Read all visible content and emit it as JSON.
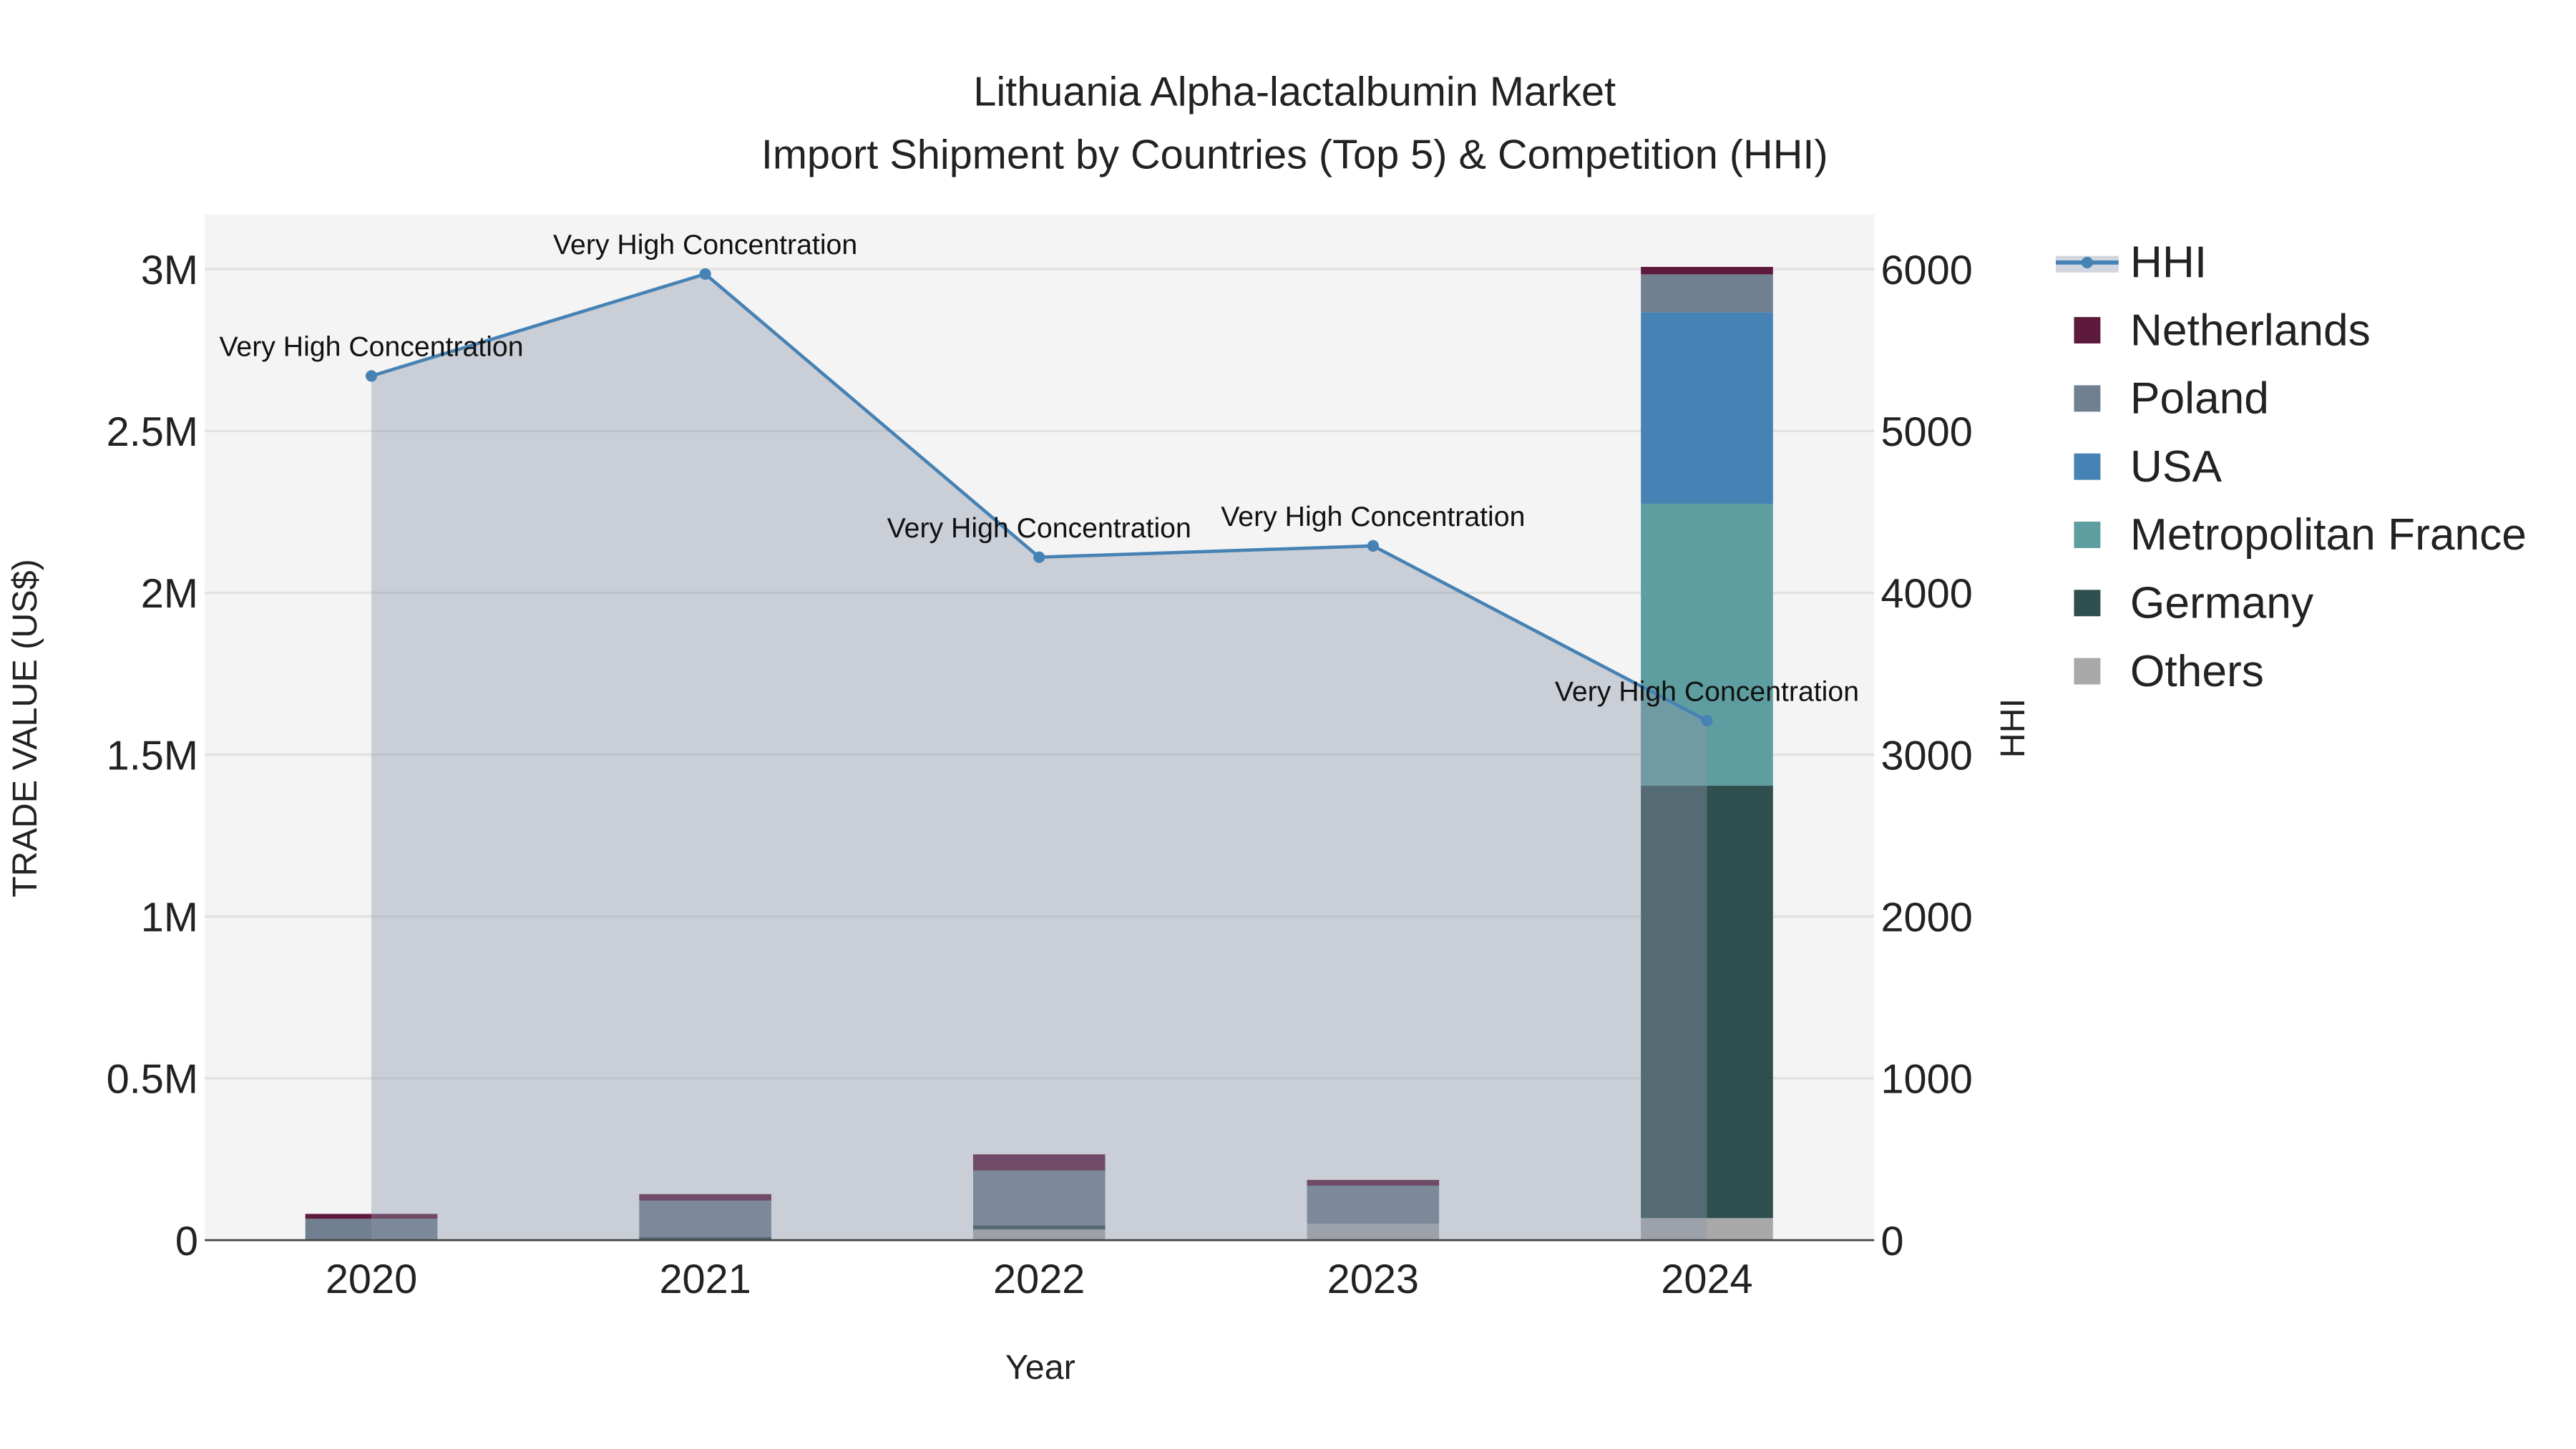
{
  "chart_data": {
    "type": "bar",
    "title": "Lithuania Alpha-lactalbumin Market",
    "subtitle": "Import Shipment by Countries (Top 5) & Competition (HHI)",
    "xlabel": "Year",
    "ylabel": "TRADE VALUE (US$)",
    "y2label": "HHI",
    "categories": [
      "2020",
      "2021",
      "2022",
      "2023",
      "2024"
    ],
    "ylim": [
      0,
      3160000
    ],
    "y2lim": [
      0,
      6320
    ],
    "yticks": [
      0,
      500000,
      1000000,
      1500000,
      2000000,
      2500000,
      3000000
    ],
    "ytick_labels": [
      "0",
      "0.5M",
      "1M",
      "1.5M",
      "2M",
      "2.5M",
      "3M"
    ],
    "y2ticks": [
      0,
      1000,
      2000,
      3000,
      4000,
      5000,
      6000
    ],
    "y2tick_labels": [
      "0",
      "1000",
      "2000",
      "3000",
      "4000",
      "5000",
      "6000"
    ],
    "grid": true,
    "legend_placement": "right",
    "stack_order": [
      "Others",
      "Germany",
      "Metropolitan France",
      "USA",
      "Poland",
      "Netherlands"
    ],
    "series": [
      {
        "name": "Netherlands",
        "color": "#5e1a3c",
        "values": [
          15000,
          20000,
          50000,
          18000,
          23000
        ]
      },
      {
        "name": "Poland",
        "color": "#708090",
        "values": [
          63000,
          113000,
          169000,
          117000,
          117000
        ]
      },
      {
        "name": "USA",
        "color": "#4682b4",
        "values": [
          0,
          0,
          0,
          0,
          592000
        ]
      },
      {
        "name": "Metropolitan France",
        "color": "#5f9ea0",
        "values": [
          0,
          0,
          0,
          0,
          871000
        ]
      },
      {
        "name": "Germany",
        "color": "#2f4f4f",
        "values": [
          3000,
          9000,
          13000,
          0,
          1336000
        ]
      },
      {
        "name": "Others",
        "color": "#a9a9a9",
        "values": [
          0,
          0,
          33000,
          51000,
          68000
        ]
      }
    ],
    "hhi": {
      "name": "HHI",
      "color": "#4682b4",
      "values": [
        5340,
        5970,
        4220,
        4290,
        3210
      ],
      "annotations": [
        "Very High Concentration",
        "Very High Concentration",
        "Very High Concentration",
        "Very High Concentration",
        "Very High Concentration"
      ]
    },
    "legend": [
      "HHI",
      "Netherlands",
      "Poland",
      "USA",
      "Metropolitan France",
      "Germany",
      "Others"
    ]
  }
}
